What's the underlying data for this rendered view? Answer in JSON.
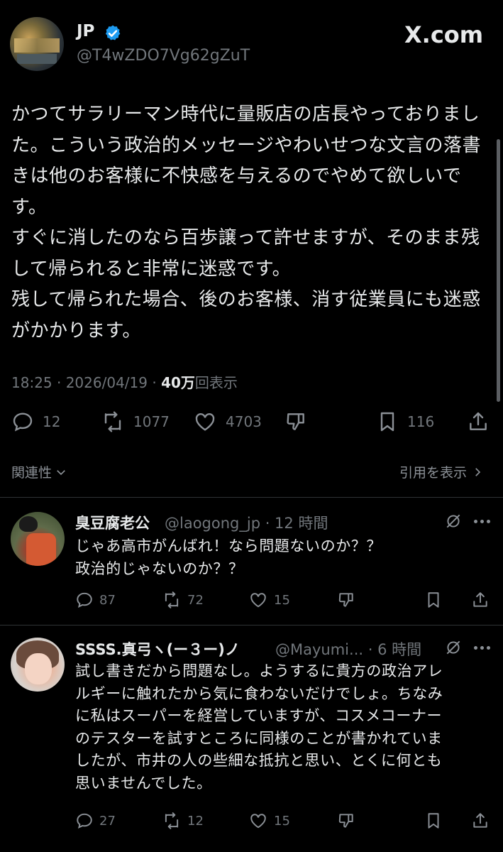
{
  "tweet": {
    "author_name": "JP",
    "author_handle": "@T4wZDO7Vg62gZuT",
    "brand": "X.com",
    "text_lines": [
      "かつてサラリーマン時代に量販店の店長やっておりまし",
      "た。こういう政治的メッセージやわいせつな文言の落書",
      "きは他のお客様に不快感を与えるのでやめて欲しいで",
      "す。",
      "すぐに消したのなら百歩譲って許せますが、そのまま残",
      "して帰られると非常に迷惑です。",
      "残して帰られた場合、後のお客様、消す従業員にも迷惑",
      "がかかります。"
    ],
    "time": "18:25 · 2026/04/19 · ",
    "views": "40万",
    "views_label": "回表示",
    "replies": "12",
    "reposts": "1077",
    "likes": "4703",
    "bookmarks": "116"
  },
  "related": {
    "label": "関連性",
    "quotes_link": "引用を表示"
  },
  "replies": [
    {
      "name": "臭豆腐老公",
      "handle": "@laogong_jp · 12 時間",
      "text_lines": [
        "じゃあ高市がんばれ！なら問題ないのか？？",
        "政治的じゃないのか？？"
      ],
      "replies": "87",
      "reposts": "72",
      "likes": "15"
    },
    {
      "name": "SSSS.真弓ヽ(ー３ー)ノ",
      "handle": "@Mayumi... · 6 時間",
      "text_lines": [
        "試し書きだから問題なし。ようするに貴方の政治アレ",
        "ルギーに触れたから気に食わないだけでしょ。ちなみ",
        "に私はスーパーを経営していますが、コスメコーナー",
        "のテスターを試すところに同様のことが書かれていま",
        "したが、市井の人の些細な抵抗と思い、とくに何とも",
        "思いませんでした。"
      ],
      "replies": "27",
      "reposts": "12",
      "likes": "15"
    }
  ],
  "colors": {
    "background": "#000000",
    "text": "#e7e9ea",
    "muted": "#71767b",
    "verified": "#1d9bf0",
    "divider": "#2f3336"
  }
}
